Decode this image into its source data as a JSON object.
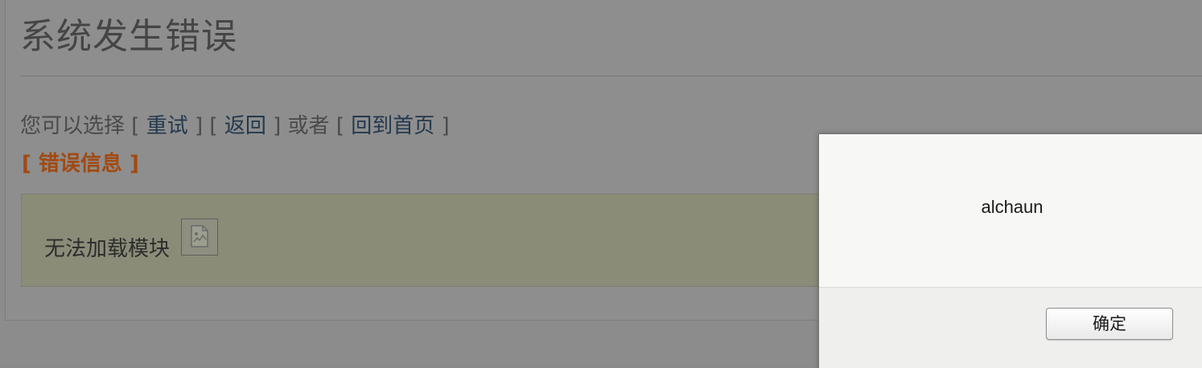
{
  "page": {
    "title": "系统发生错误",
    "options": {
      "prefix": "您可以选择",
      "open_bracket": "[",
      "close_bracket": "]",
      "retry_label": "重试",
      "back_label": "返回",
      "or_text": "或者",
      "home_label": "回到首页"
    },
    "error_info_label": "[ 错误信息 ]",
    "error_message": "无法加载模块",
    "broken_image_icon": "broken-image-icon"
  },
  "alert": {
    "message": "alchaun",
    "ok_label": "确定"
  },
  "colors": {
    "overlay": "#8c8c8c",
    "link": "#24384e",
    "error_info": "#a14a12",
    "error_box": "#8b8c78",
    "dialog_bg": "#f7f7f5"
  }
}
